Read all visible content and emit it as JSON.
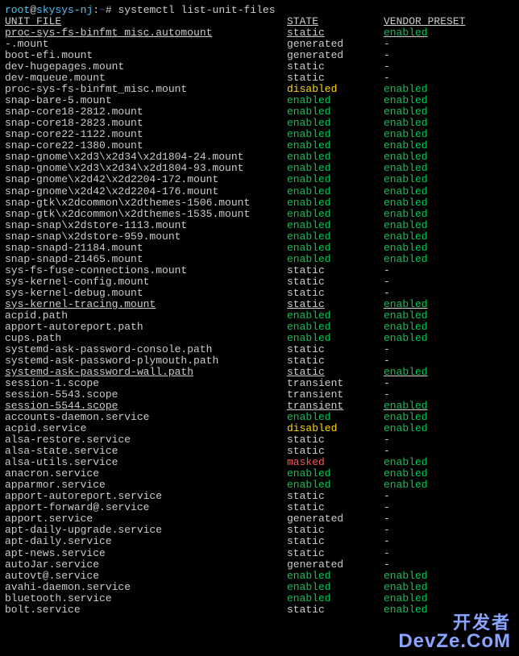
{
  "prompt": {
    "user": "root",
    "host": "skysys-nj",
    "path": "~",
    "symbol": "#",
    "command": "systemctl list-unit-files"
  },
  "headers": {
    "unit": "UNIT FILE",
    "state": "STATE",
    "preset": "VENDOR PRESET"
  },
  "rows": [
    {
      "unit": "proc-sys-fs-binfmt_misc.automount",
      "state": "static",
      "preset": "enabled",
      "ul": true,
      "sc": "c-gray",
      "pc": "c-green"
    },
    {
      "unit": "-.mount",
      "state": "generated",
      "preset": "-",
      "sc": "c-gray",
      "pc": "c-gray"
    },
    {
      "unit": "boot-efi.mount",
      "state": "generated",
      "preset": "-",
      "sc": "c-gray",
      "pc": "c-gray"
    },
    {
      "unit": "dev-hugepages.mount",
      "state": "static",
      "preset": "-",
      "sc": "c-gray",
      "pc": "c-gray"
    },
    {
      "unit": "dev-mqueue.mount",
      "state": "static",
      "preset": "-",
      "sc": "c-gray",
      "pc": "c-gray"
    },
    {
      "unit": "proc-sys-fs-binfmt_misc.mount",
      "state": "disabled",
      "preset": "enabled",
      "sc": "c-yellow",
      "pc": "c-green"
    },
    {
      "unit": "snap-bare-5.mount",
      "state": "enabled",
      "preset": "enabled",
      "sc": "c-green",
      "pc": "c-green"
    },
    {
      "unit": "snap-core18-2812.mount",
      "state": "enabled",
      "preset": "enabled",
      "sc": "c-green",
      "pc": "c-green"
    },
    {
      "unit": "snap-core18-2823.mount",
      "state": "enabled",
      "preset": "enabled",
      "sc": "c-green",
      "pc": "c-green"
    },
    {
      "unit": "snap-core22-1122.mount",
      "state": "enabled",
      "preset": "enabled",
      "sc": "c-green",
      "pc": "c-green"
    },
    {
      "unit": "snap-core22-1380.mount",
      "state": "enabled",
      "preset": "enabled",
      "sc": "c-green",
      "pc": "c-green"
    },
    {
      "unit": "snap-gnome\\x2d3\\x2d34\\x2d1804-24.mount",
      "state": "enabled",
      "preset": "enabled",
      "sc": "c-green",
      "pc": "c-green"
    },
    {
      "unit": "snap-gnome\\x2d3\\x2d34\\x2d1804-93.mount",
      "state": "enabled",
      "preset": "enabled",
      "sc": "c-green",
      "pc": "c-green"
    },
    {
      "unit": "snap-gnome\\x2d42\\x2d2204-172.mount",
      "state": "enabled",
      "preset": "enabled",
      "sc": "c-green",
      "pc": "c-green"
    },
    {
      "unit": "snap-gnome\\x2d42\\x2d2204-176.mount",
      "state": "enabled",
      "preset": "enabled",
      "sc": "c-green",
      "pc": "c-green"
    },
    {
      "unit": "snap-gtk\\x2dcommon\\x2dthemes-1506.mount",
      "state": "enabled",
      "preset": "enabled",
      "sc": "c-green",
      "pc": "c-green"
    },
    {
      "unit": "snap-gtk\\x2dcommon\\x2dthemes-1535.mount",
      "state": "enabled",
      "preset": "enabled",
      "sc": "c-green",
      "pc": "c-green"
    },
    {
      "unit": "snap-snap\\x2dstore-1113.mount",
      "state": "enabled",
      "preset": "enabled",
      "sc": "c-green",
      "pc": "c-green"
    },
    {
      "unit": "snap-snap\\x2dstore-959.mount",
      "state": "enabled",
      "preset": "enabled",
      "sc": "c-green",
      "pc": "c-green"
    },
    {
      "unit": "snap-snapd-21184.mount",
      "state": "enabled",
      "preset": "enabled",
      "sc": "c-green",
      "pc": "c-green"
    },
    {
      "unit": "snap-snapd-21465.mount",
      "state": "enabled",
      "preset": "enabled",
      "sc": "c-green",
      "pc": "c-green"
    },
    {
      "unit": "sys-fs-fuse-connections.mount",
      "state": "static",
      "preset": "-",
      "sc": "c-gray",
      "pc": "c-gray"
    },
    {
      "unit": "sys-kernel-config.mount",
      "state": "static",
      "preset": "-",
      "sc": "c-gray",
      "pc": "c-gray"
    },
    {
      "unit": "sys-kernel-debug.mount",
      "state": "static",
      "preset": "-",
      "sc": "c-gray",
      "pc": "c-gray"
    },
    {
      "unit": "sys-kernel-tracing.mount",
      "state": "static",
      "preset": "enabled",
      "ul": true,
      "sc": "c-gray",
      "pc": "c-green"
    },
    {
      "unit": "acpid.path",
      "state": "enabled",
      "preset": "enabled",
      "sc": "c-green",
      "pc": "c-green"
    },
    {
      "unit": "apport-autoreport.path",
      "state": "enabled",
      "preset": "enabled",
      "sc": "c-green",
      "pc": "c-green"
    },
    {
      "unit": "cups.path",
      "state": "enabled",
      "preset": "enabled",
      "sc": "c-green",
      "pc": "c-green"
    },
    {
      "unit": "systemd-ask-password-console.path",
      "state": "static",
      "preset": "-",
      "sc": "c-gray",
      "pc": "c-gray"
    },
    {
      "unit": "systemd-ask-password-plymouth.path",
      "state": "static",
      "preset": "-",
      "sc": "c-gray",
      "pc": "c-gray"
    },
    {
      "unit": "systemd-ask-password-wall.path",
      "state": "static",
      "preset": "enabled",
      "ul": true,
      "sc": "c-gray",
      "pc": "c-green"
    },
    {
      "unit": "session-1.scope",
      "state": "transient",
      "preset": "-",
      "sc": "c-gray",
      "pc": "c-gray"
    },
    {
      "unit": "session-5543.scope",
      "state": "transient",
      "preset": "-",
      "sc": "c-gray",
      "pc": "c-gray"
    },
    {
      "unit": "session-5544.scope",
      "state": "transient",
      "preset": "enabled",
      "ul": true,
      "sc": "c-gray",
      "pc": "c-green"
    },
    {
      "unit": "accounts-daemon.service",
      "state": "enabled",
      "preset": "enabled",
      "sc": "c-green",
      "pc": "c-green"
    },
    {
      "unit": "acpid.service",
      "state": "disabled",
      "preset": "enabled",
      "sc": "c-yellow",
      "pc": "c-green"
    },
    {
      "unit": "alsa-restore.service",
      "state": "static",
      "preset": "-",
      "sc": "c-gray",
      "pc": "c-gray"
    },
    {
      "unit": "alsa-state.service",
      "state": "static",
      "preset": "-",
      "sc": "c-gray",
      "pc": "c-gray"
    },
    {
      "unit": "alsa-utils.service",
      "state": "masked",
      "preset": "enabled",
      "sc": "c-red",
      "pc": "c-green"
    },
    {
      "unit": "anacron.service",
      "state": "enabled",
      "preset": "enabled",
      "sc": "c-green",
      "pc": "c-green"
    },
    {
      "unit": "apparmor.service",
      "state": "enabled",
      "preset": "enabled",
      "sc": "c-green",
      "pc": "c-green"
    },
    {
      "unit": "apport-autoreport.service",
      "state": "static",
      "preset": "-",
      "sc": "c-gray",
      "pc": "c-gray"
    },
    {
      "unit": "apport-forward@.service",
      "state": "static",
      "preset": "-",
      "sc": "c-gray",
      "pc": "c-gray"
    },
    {
      "unit": "apport.service",
      "state": "generated",
      "preset": "-",
      "sc": "c-gray",
      "pc": "c-gray"
    },
    {
      "unit": "apt-daily-upgrade.service",
      "state": "static",
      "preset": "-",
      "sc": "c-gray",
      "pc": "c-gray"
    },
    {
      "unit": "apt-daily.service",
      "state": "static",
      "preset": "-",
      "sc": "c-gray",
      "pc": "c-gray"
    },
    {
      "unit": "apt-news.service",
      "state": "static",
      "preset": "-",
      "sc": "c-gray",
      "pc": "c-gray"
    },
    {
      "unit": "autoJar.service",
      "state": "generated",
      "preset": "-",
      "sc": "c-gray",
      "pc": "c-gray"
    },
    {
      "unit": "autovt@.service",
      "state": "enabled",
      "preset": "enabled",
      "sc": "c-green",
      "pc": "c-green"
    },
    {
      "unit": "avahi-daemon.service",
      "state": "enabled",
      "preset": "enabled",
      "sc": "c-green",
      "pc": "c-green"
    },
    {
      "unit": "bluetooth.service",
      "state": "enabled",
      "preset": "enabled",
      "sc": "c-green",
      "pc": "c-green"
    },
    {
      "unit": "bolt.service",
      "state": "static",
      "preset": "enabled",
      "sc": "c-gray",
      "pc": "c-green"
    }
  ],
  "watermark": {
    "line1": "开发者",
    "line2": "DevZe.CoM"
  }
}
